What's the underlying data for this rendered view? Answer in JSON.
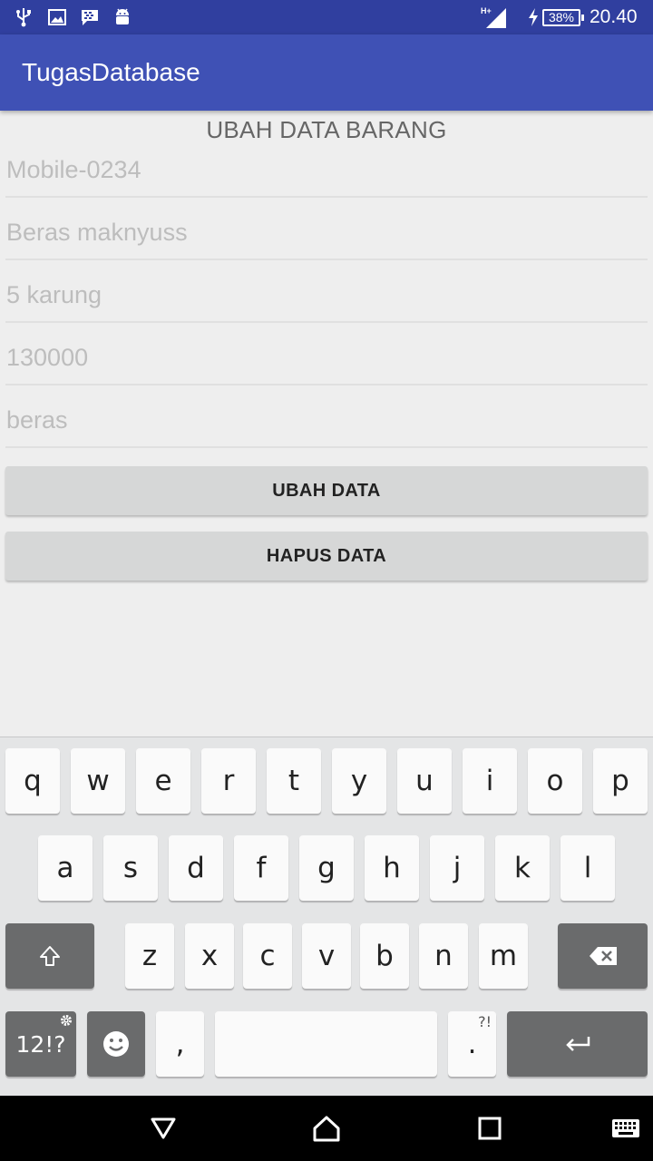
{
  "status_bar": {
    "icons": [
      "usb-icon",
      "image-icon",
      "bbm-icon",
      "android-icon",
      "signal-hplus-icon",
      "charging-icon"
    ],
    "network": "H+",
    "battery": "38%",
    "time": "20.40"
  },
  "app_bar": {
    "title": "TugasDatabase"
  },
  "form": {
    "heading": "UBAH DATA BARANG",
    "fields": [
      {
        "placeholder": "Mobile-0234"
      },
      {
        "placeholder": "Beras maknyuss"
      },
      {
        "placeholder": "5 karung"
      },
      {
        "placeholder": "130000"
      },
      {
        "placeholder": "beras"
      }
    ],
    "buttons": {
      "update": "UBAH DATA",
      "delete": "HAPUS DATA"
    }
  },
  "keyboard": {
    "row1": [
      "q",
      "w",
      "e",
      "r",
      "t",
      "y",
      "u",
      "i",
      "o",
      "p"
    ],
    "row2": [
      "a",
      "s",
      "d",
      "f",
      "g",
      "h",
      "j",
      "k",
      "l"
    ],
    "row3": [
      "z",
      "x",
      "c",
      "v",
      "b",
      "n",
      "m"
    ],
    "symbols_label": "12!?",
    "comma": ",",
    "period": ".",
    "period_hint": "?!",
    "special_keys": [
      "shift-icon",
      "backspace-icon",
      "emoji-icon",
      "settings-icon",
      "enter-icon"
    ]
  },
  "nav_bar": {
    "icons": [
      "back-icon",
      "home-icon",
      "recents-icon",
      "keyboard-icon"
    ]
  }
}
